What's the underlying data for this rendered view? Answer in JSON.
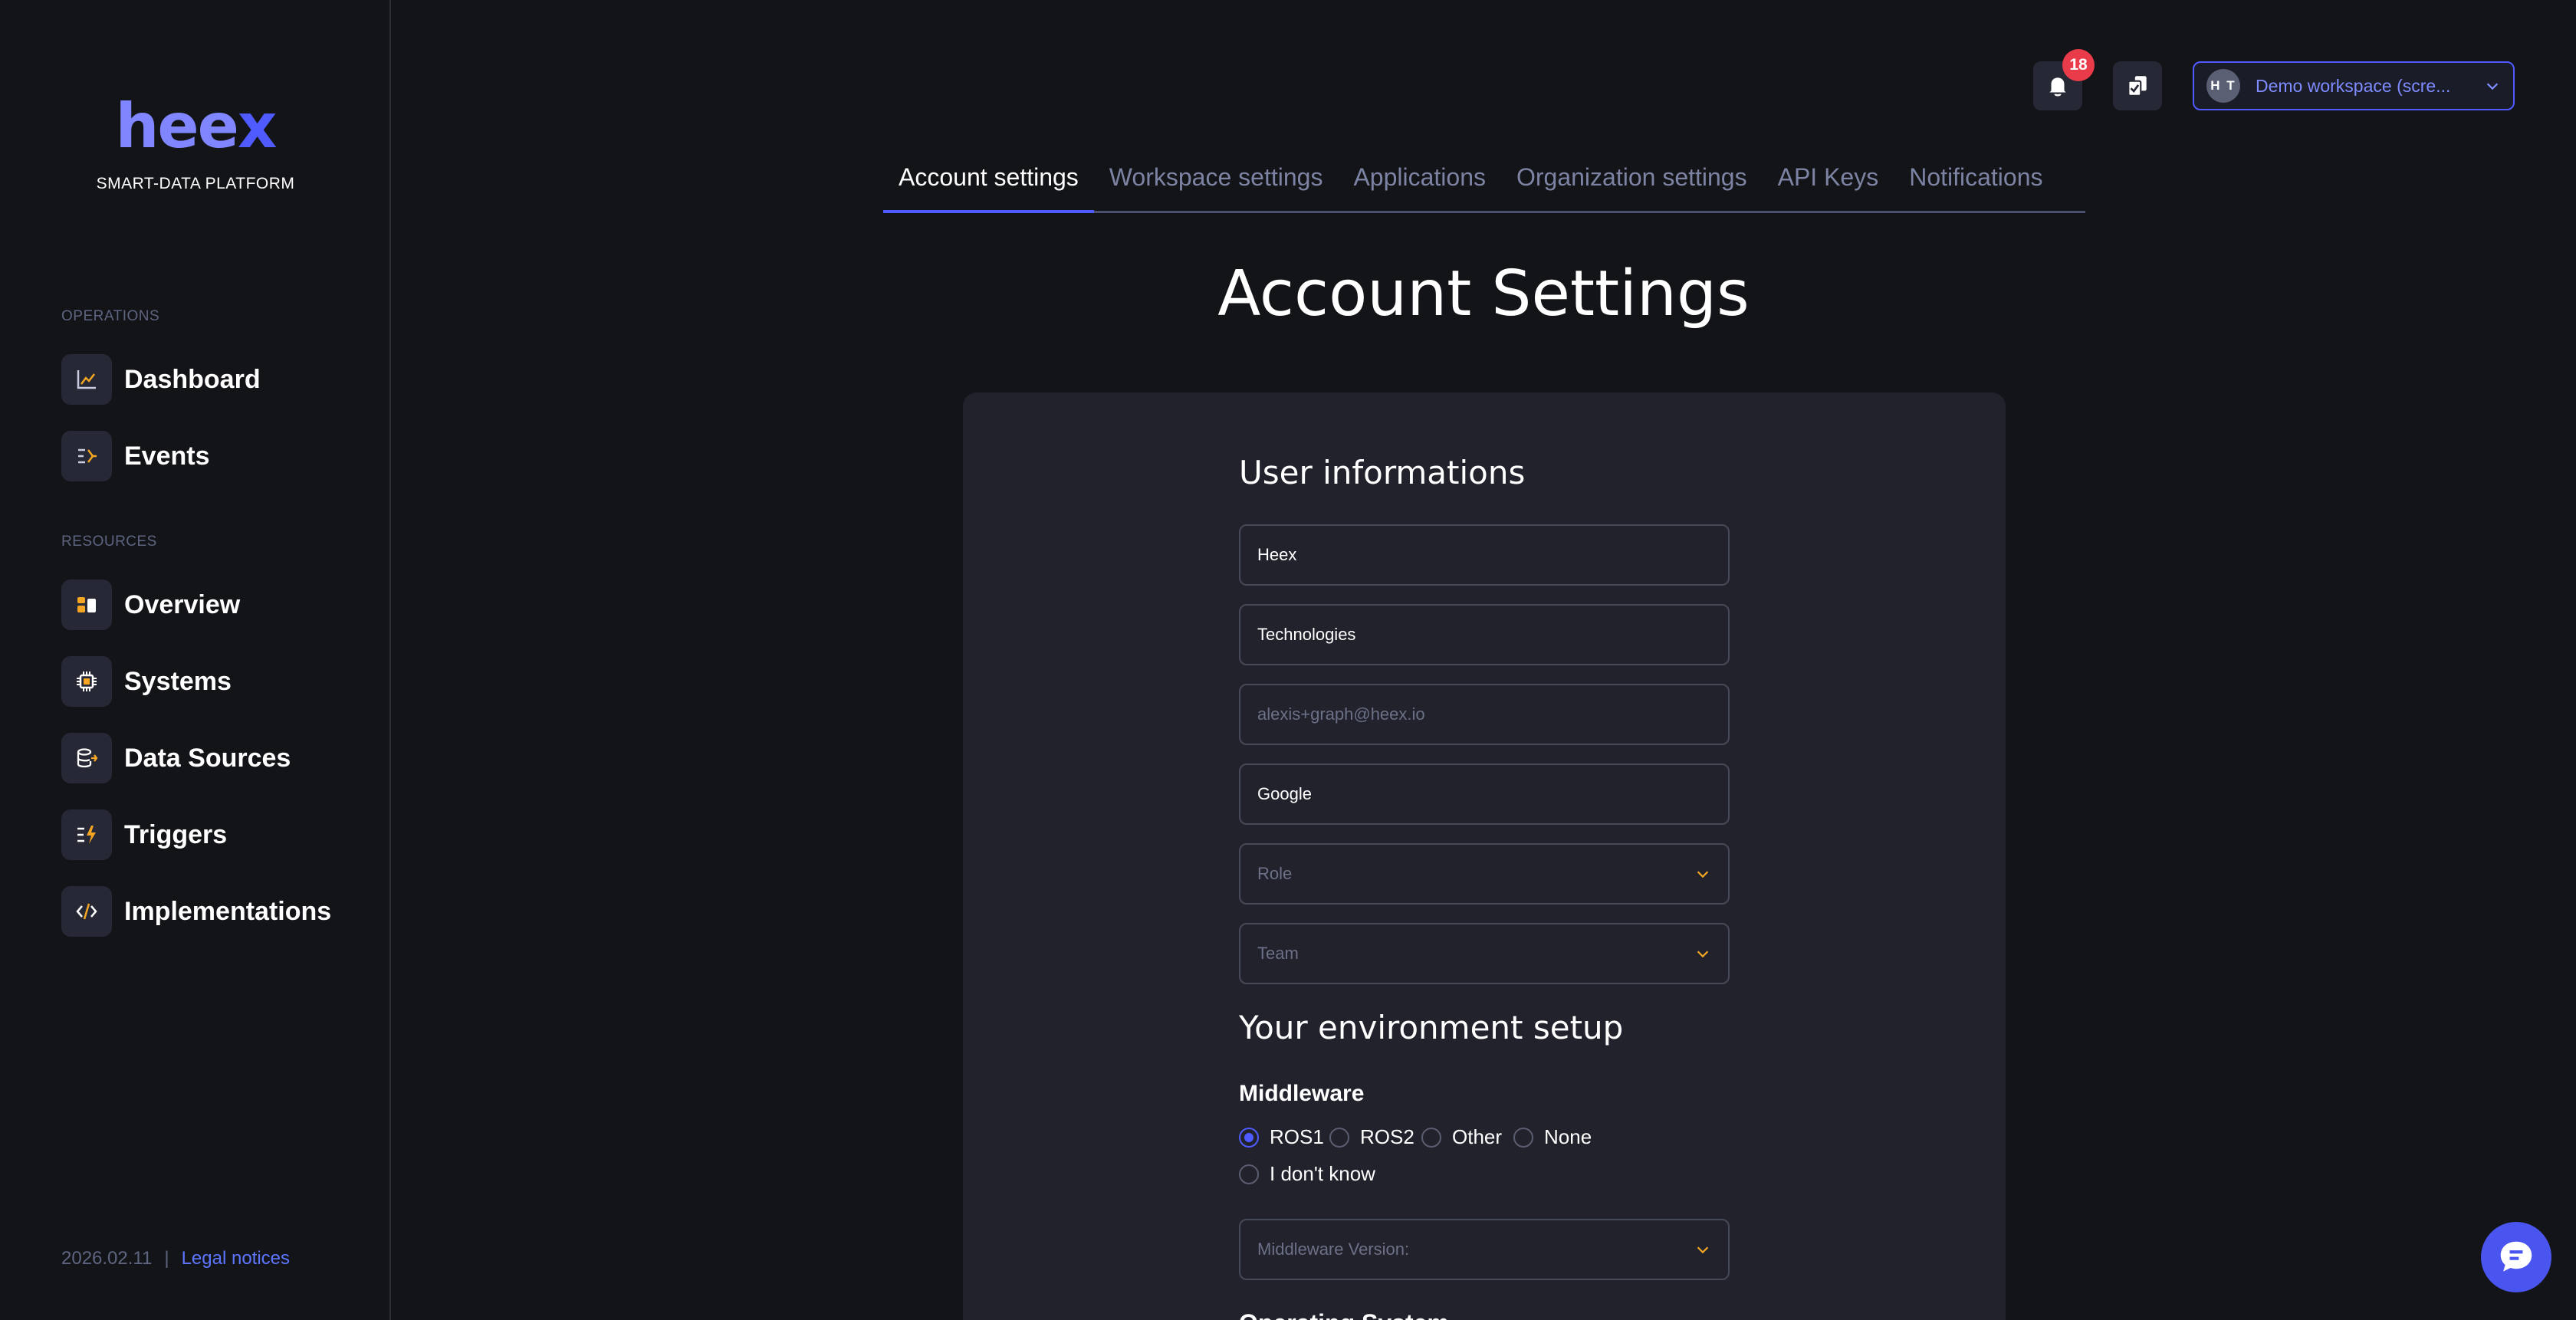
{
  "brand": {
    "logo": "hee",
    "logo_x": "x",
    "tagline": "SMART-DATA PLATFORM",
    "accent_color": "#4f5bff"
  },
  "sidebar": {
    "operations_label": "OPERATIONS",
    "resources_label": "RESOURCES",
    "operations": [
      {
        "label": "Dashboard",
        "icon": "chart-line-icon"
      },
      {
        "label": "Events",
        "icon": "events-list-icon"
      }
    ],
    "resources": [
      {
        "label": "Overview",
        "icon": "overview-blocks-icon"
      },
      {
        "label": "Systems",
        "icon": "chip-icon"
      },
      {
        "label": "Data Sources",
        "icon": "database-icon"
      },
      {
        "label": "Triggers",
        "icon": "trigger-bolt-icon"
      },
      {
        "label": "Implementations",
        "icon": "code-icon"
      }
    ],
    "footer": {
      "version": "2026.02.11",
      "separator": "|",
      "legal": "Legal notices"
    }
  },
  "topbar": {
    "notification_count": "18",
    "workspace": {
      "initials": "H T",
      "name": "Demo workspace (scre..."
    }
  },
  "tabs": [
    {
      "label": "Account settings",
      "active": true
    },
    {
      "label": "Workspace settings",
      "active": false
    },
    {
      "label": "Applications",
      "active": false
    },
    {
      "label": "Organization settings",
      "active": false
    },
    {
      "label": "API Keys",
      "active": false
    },
    {
      "label": "Notifications",
      "active": false
    }
  ],
  "page": {
    "title": "Account Settings"
  },
  "user_info": {
    "heading": "User informations",
    "first_name": "Heex",
    "last_name": "Technologies",
    "email": "alexis+graph@heex.io",
    "company": "Google",
    "role_placeholder": "Role",
    "team_placeholder": "Team"
  },
  "environment": {
    "heading": "Your environment setup",
    "middleware_label": "Middleware",
    "middleware_options": [
      {
        "label": "ROS1",
        "checked": true
      },
      {
        "label": "ROS2",
        "checked": false
      },
      {
        "label": "Other",
        "checked": false
      },
      {
        "label": "None",
        "checked": false
      },
      {
        "label": "I don't know",
        "checked": false
      }
    ],
    "middleware_version_placeholder": "Middleware Version:",
    "next_heading": "Operating System"
  }
}
